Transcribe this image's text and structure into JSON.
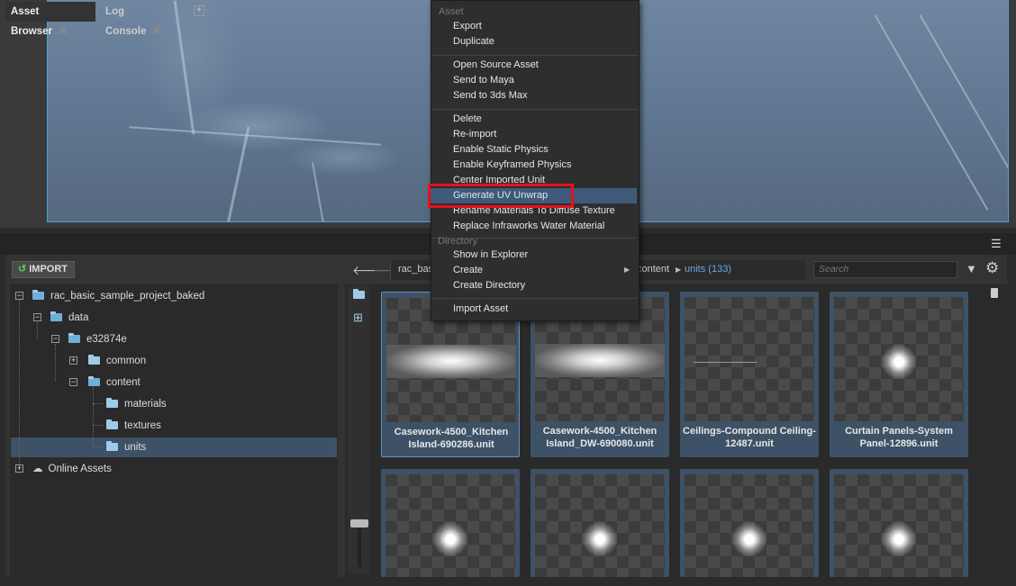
{
  "tabs": [
    {
      "label": "Asset Browser"
    },
    {
      "label": "Log Console"
    }
  ],
  "toolbar": {
    "import_label": "IMPORT",
    "search_placeholder": "Search"
  },
  "breadcrumb": {
    "first": "rac_basi",
    "content": "content",
    "current": "units (133)"
  },
  "tree": {
    "root": "rac_basic_sample_project_baked",
    "data": "data",
    "hash": "e32874e",
    "common": "common",
    "content": "content",
    "materials": "materials",
    "textures": "textures",
    "units": "units",
    "online": "Online Assets"
  },
  "assets": [
    {
      "name": "Casework-4500_Kitchen Island-690286.unit"
    },
    {
      "name": "Casework-4500_Kitchen Island_DW-690080.unit"
    },
    {
      "name": "Ceilings-Compound Ceiling-12487.unit"
    },
    {
      "name": "Curtain Panels-System Panel-12896.unit"
    }
  ],
  "context_menu": {
    "asset_header": "Asset",
    "export": "Export",
    "duplicate": "Duplicate",
    "open_source": "Open Source Asset",
    "send_maya": "Send to Maya",
    "send_3ds": "Send to 3ds Max",
    "delete": "Delete",
    "reimport": "Re-import",
    "static_physics": "Enable Static Physics",
    "keyframed_physics": "Enable Keyframed Physics",
    "center_unit": "Center Imported Unit",
    "gen_uv": "Generate UV Unwrap",
    "rename_mats": "Rename Materials To Diffuse Texture",
    "replace_water": "Replace Infraworks Water Material",
    "directory_header": "Directory",
    "show_explorer": "Show in Explorer",
    "create": "Create",
    "create_dir": "Create Directory",
    "import_asset": "Import Asset"
  },
  "colors": {
    "accent": "#4aa3d8",
    "selection": "#3d5266",
    "highlight_box": "#e8101b",
    "breadcrumb_current": "#6aa7e0"
  }
}
